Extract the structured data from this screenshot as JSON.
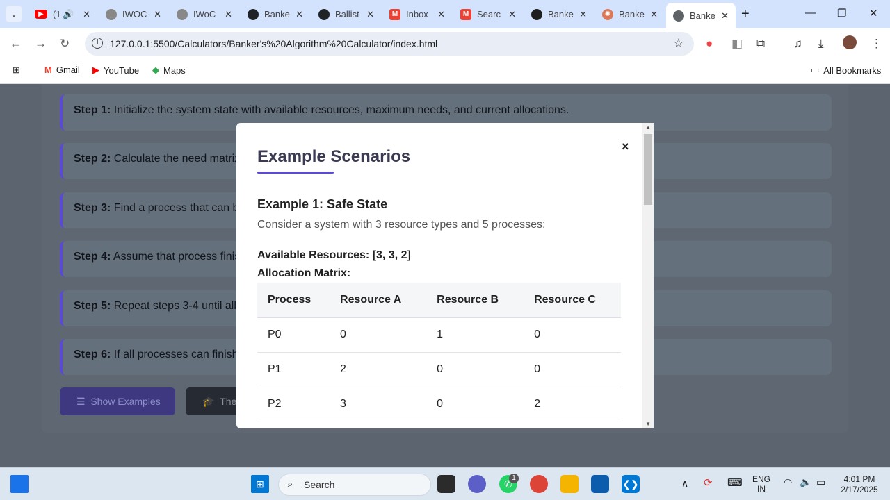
{
  "tabs": [
    {
      "title": "(1",
      "fav": "youtube-icon",
      "color": "#ff0000",
      "extra": "speaker"
    },
    {
      "title": "IWOC",
      "fav": "iwoc-icon",
      "color": "#777777"
    },
    {
      "title": "IWoC",
      "fav": "iwoc-icon",
      "color": "#777777"
    },
    {
      "title": "Banke",
      "fav": "github-icon",
      "color": "#1f2328"
    },
    {
      "title": "Ballist",
      "fav": "github-icon",
      "color": "#1f2328"
    },
    {
      "title": "Inbox",
      "fav": "gmail-icon",
      "color": "#ea4335"
    },
    {
      "title": "Searc",
      "fav": "gmail-icon",
      "color": "#ea4335"
    },
    {
      "title": "Banke",
      "fav": "chatgpt-icon",
      "color": "#1f1f1f"
    },
    {
      "title": "Banke",
      "fav": "claude-icon",
      "color": "#d97757"
    },
    {
      "title": "Banke",
      "fav": "globe-icon",
      "color": "#5f6368"
    }
  ],
  "omnibox": {
    "url": "127.0.0.1:5500/Calculators/Banker's%20Algorithm%20Calculator/index.html"
  },
  "bookmarks": {
    "items": [
      "Gmail",
      "YouTube",
      "Maps"
    ],
    "all": "All Bookmarks"
  },
  "steps": [
    {
      "label": "Step 1:",
      "text": "Initialize the system state with available resources, maximum needs, and current allocations."
    },
    {
      "label": "Step 2:",
      "text": "Calculate the need matrix"
    },
    {
      "label": "Step 3:",
      "text": "Find a process that can b"
    },
    {
      "label": "Step 4:",
      "text": "Assume that process finis"
    },
    {
      "label": "Step 5:",
      "text": "Repeat steps 3-4 until all"
    },
    {
      "label": "Step 6:",
      "text": "If all processes can finish"
    }
  ],
  "buttons": {
    "show_examples": "Show Examples",
    "theory": "The"
  },
  "modal": {
    "title": "Example Scenarios",
    "example_title": "Example 1: Safe State",
    "description": "Consider a system with 3 resource types and 5 processes:",
    "available": "Available Resources: [3, 3, 2]",
    "allocation_label": "Allocation Matrix:",
    "headers": [
      "Process",
      "Resource A",
      "Resource B",
      "Resource C"
    ],
    "rows": [
      [
        "P0",
        "0",
        "1",
        "0"
      ],
      [
        "P1",
        "2",
        "0",
        "0"
      ],
      [
        "P2",
        "3",
        "0",
        "2"
      ]
    ],
    "close": "×"
  },
  "taskbar": {
    "search": "Search",
    "lang1": "ENG",
    "lang2": "IN",
    "time": "4:01 PM",
    "date": "2/17/2025",
    "whatsapp_badge": "1"
  },
  "colors": {
    "accent": "#5b4bd1",
    "overlay": "#5c6470"
  }
}
